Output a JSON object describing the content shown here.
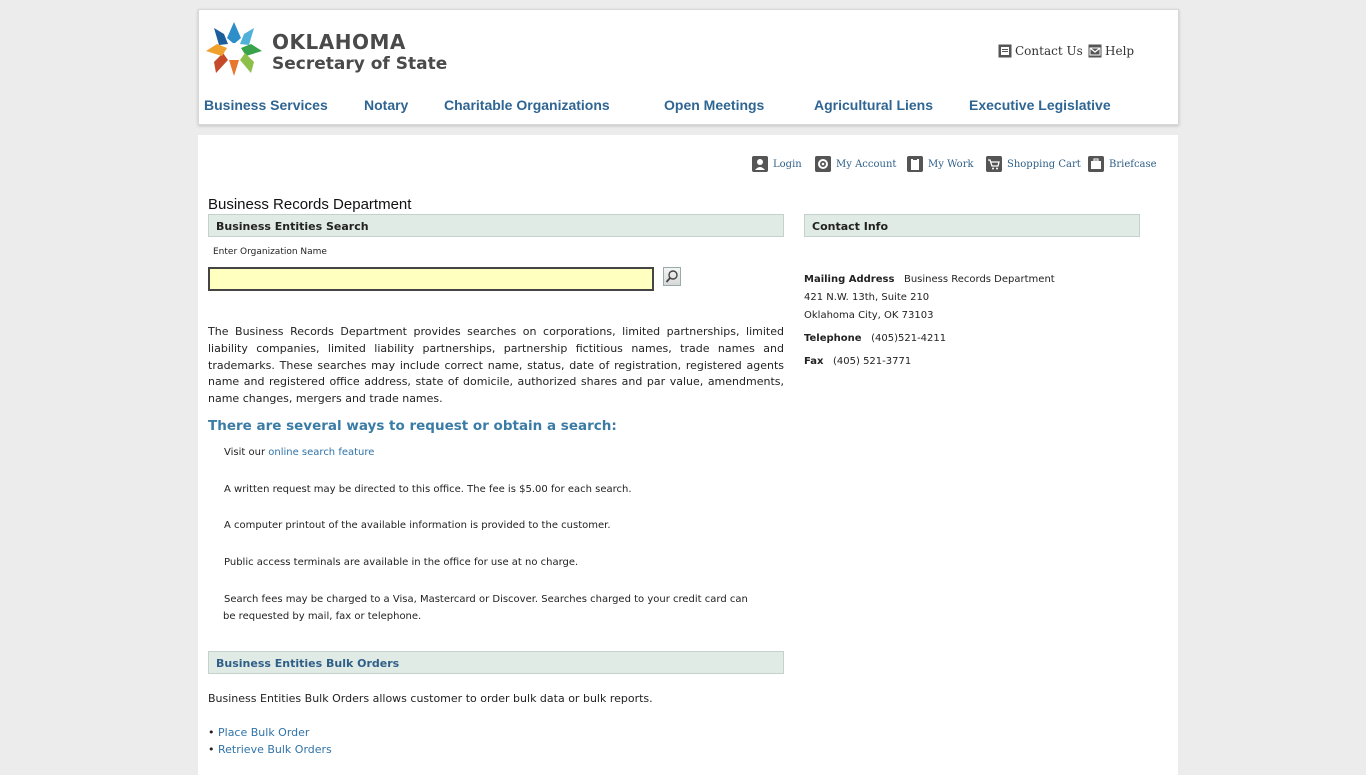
{
  "header": {
    "logo_title": "OKLAHOMA",
    "logo_subtitle": "Secretary of State",
    "top_links": [
      "Contact Us",
      "Help"
    ],
    "nav": [
      "Business Services",
      "Notary",
      "Charitable Organizations",
      "Open Meetings",
      "Agricultural Liens",
      "Executive Legislative"
    ]
  },
  "util": [
    "Login",
    "My Account",
    "My Work",
    "Shopping Cart",
    "Briefcase"
  ],
  "page_title": "Business Records Department",
  "search": {
    "heading": "Business Entities Search",
    "label": "Enter Organization Name",
    "value": "",
    "placeholder": ""
  },
  "description": "The Business Records Department provides searches on corporations, limited partnerships, limited liability companies, limited liability partnerships, partnership fictitious names, trade names and trademarks. These searches may include correct name, status, date of registration, registered agents name and registered office address, state of domicile, authorized shares and par value, amendments, name changes, mergers and trade names.",
  "ways": {
    "title": "There are several ways to request or obtain a search:",
    "visit_prefix": "Visit our",
    "visit_link": "online search feature",
    "items": [
      "A written request may be directed to this office. The fee is $5.00 for each search.",
      "A computer printout of the available information is provided to the customer.",
      "Public access terminals are available in the office for use at no charge.",
      "Search fees may be charged to a Visa, Mastercard or Discover. Searches charged to your credit card can",
      "be requested by mail, fax or telephone."
    ]
  },
  "bulk": {
    "heading": "Business Entities Bulk Orders",
    "desc": "Business Entities Bulk Orders allows customer to order bulk data or bulk reports.",
    "links": [
      "Place Bulk Order",
      "Retrieve Bulk Orders"
    ]
  },
  "contact": {
    "heading": "Contact Info",
    "mailing_label": "Mailing Address",
    "mailing_name": "Business Records Department",
    "address1": "421 N.W. 13th, Suite 210",
    "address2": "Oklahoma City, OK 73103",
    "tel_label": "Telephone",
    "tel": "(405)521-4211",
    "fax_label": "Fax",
    "fax": "(405) 521-3771"
  },
  "colors": {
    "nav": "#2f6593",
    "ways_title": "#3a7ca6",
    "link": "#3073a8",
    "section_bg": "#e1ebe6",
    "input_bg": "#ffffc0"
  }
}
